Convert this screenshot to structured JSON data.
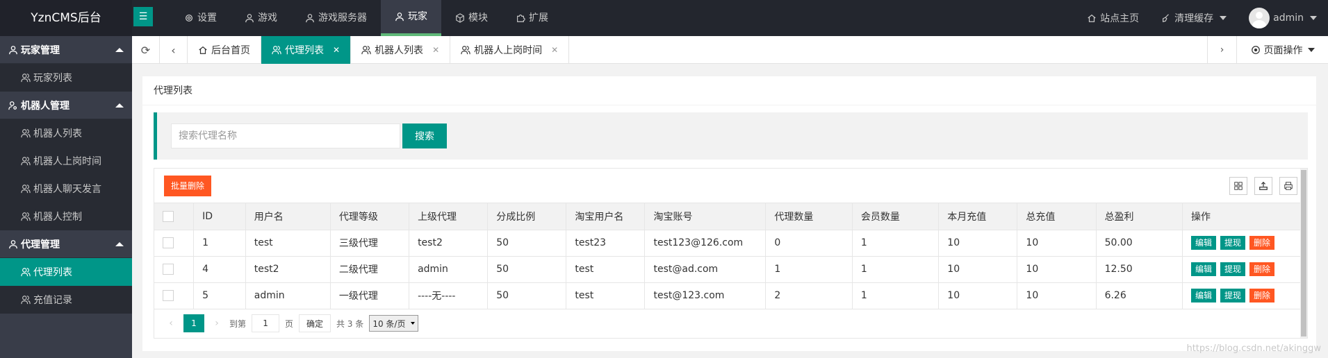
{
  "app": {
    "logo": "YznCMS后台"
  },
  "topnav": [
    {
      "label": "设置",
      "icon": "gear-icon"
    },
    {
      "label": "游戏",
      "icon": "user-icon"
    },
    {
      "label": "游戏服务器",
      "icon": "user-icon"
    },
    {
      "label": "玩家",
      "icon": "user-icon",
      "active": true
    },
    {
      "label": "模块",
      "icon": "cube-icon"
    },
    {
      "label": "扩展",
      "icon": "puzzle-icon"
    }
  ],
  "topright": {
    "site_home": "站点主页",
    "clear_cache": "清理缓存",
    "user": "admin"
  },
  "sidebar": {
    "groups": [
      {
        "label": "玩家管理",
        "items": [
          "玩家列表"
        ]
      },
      {
        "label": "机器人管理",
        "items": [
          "机器人列表",
          "机器人上岗时间",
          "机器人聊天发言",
          "机器人控制"
        ]
      },
      {
        "label": "代理管理",
        "items": [
          "代理列表",
          "充值记录"
        ]
      }
    ],
    "active_item": "代理列表"
  },
  "tabs": [
    {
      "label": "后台首页",
      "icon": "home-icon",
      "closable": false
    },
    {
      "label": "代理列表",
      "icon": "users-icon",
      "closable": true,
      "active": true
    },
    {
      "label": "机器人列表",
      "icon": "users-icon",
      "closable": true
    },
    {
      "label": "机器人上岗时间",
      "icon": "users-icon",
      "closable": true
    }
  ],
  "page_ops": "页面操作",
  "card": {
    "title": "代理列表"
  },
  "search": {
    "placeholder": "搜索代理名称",
    "button": "搜索"
  },
  "toolbar": {
    "batch_delete": "批量删除"
  },
  "table": {
    "columns": [
      "ID",
      "用户名",
      "代理等级",
      "上级代理",
      "分成比例",
      "淘宝用户名",
      "淘宝账号",
      "代理数量",
      "会员数量",
      "本月充值",
      "总充值",
      "总盈利",
      "操作"
    ],
    "rows": [
      [
        "1",
        "test",
        "三级代理",
        "test2",
        "50",
        "test23",
        "test123@126.com",
        "0",
        "1",
        "10",
        "10",
        "50.00"
      ],
      [
        "4",
        "test2",
        "二级代理",
        "admin",
        "50",
        "test",
        "test@ad.com",
        "1",
        "1",
        "10",
        "10",
        "12.50"
      ],
      [
        "5",
        "admin",
        "一级代理",
        "----无----",
        "50",
        "test",
        "test@123.com",
        "2",
        "1",
        "10",
        "10",
        "6.26"
      ]
    ],
    "actions": [
      "编辑",
      "提现",
      "删除"
    ]
  },
  "pager": {
    "current": "1",
    "goto_label": "到第",
    "goto_value": "1",
    "page_unit": "页",
    "ok": "确定",
    "total": "共 3 条",
    "page_size": "10 条/页"
  },
  "watermark": "https://blog.csdn.net/akinggw"
}
